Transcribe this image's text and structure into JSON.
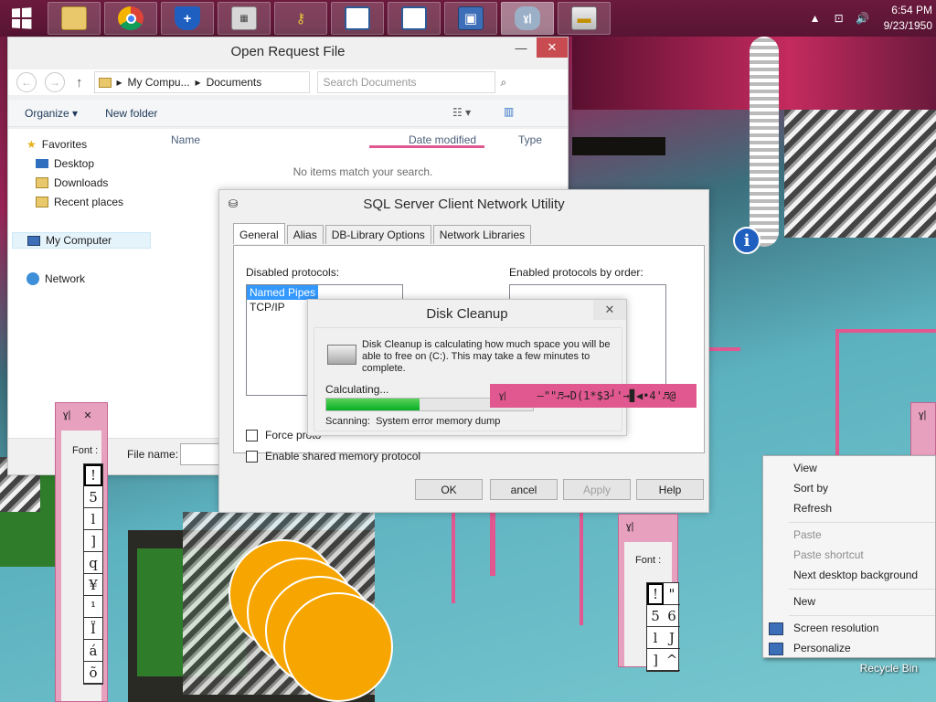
{
  "taskbar": {
    "clock_time": "6:54 PM",
    "clock_date": "9/23/1950",
    "pinned": [
      "file-explorer-icon",
      "chrome-icon",
      "defender-icon",
      "calculator-icon",
      "key-icon",
      "window-icon",
      "window-icon",
      "network-icon",
      "font-viewer-icon",
      "disk-cleanup-icon"
    ]
  },
  "explorer": {
    "title": "Open Request File",
    "address_root": "My Compu...",
    "address_folder": "Documents",
    "search_placeholder": "Search Documents",
    "organize": "Organize",
    "new_folder": "New folder",
    "sidebar": {
      "favorites": "Favorites",
      "desktop": "Desktop",
      "downloads": "Downloads",
      "recent": "Recent places",
      "mycomputer": "My Computer",
      "network": "Network"
    },
    "columns": {
      "name": "Name",
      "date": "Date modified",
      "type": "Type"
    },
    "empty": "No items match your search.",
    "file_name_label": "File name:"
  },
  "sql": {
    "title": "SQL Server Client Network Utility",
    "tabs": [
      "General",
      "Alias",
      "DB-Library Options",
      "Network Libraries"
    ],
    "disabled_label": "Disabled protocols:",
    "enabled_label": "Enabled protocols by order:",
    "disabled_items": [
      "Named Pipes",
      "TCP/IP"
    ],
    "force_label": "Force proto",
    "shared_label": "Enable shared memory protocol",
    "ok": "OK",
    "cancel": "ancel",
    "apply": "Apply",
    "help": "Help"
  },
  "disk": {
    "title": "Disk Cleanup",
    "message": "Disk Cleanup is calculating how much space you will be able to free on  (C:). This may take a few minutes to complete.",
    "calculating": "Calculating...",
    "scanning_label": "Scanning:",
    "scanning_value": "System error memory dump",
    "progress": 0.45
  },
  "font_windows": {
    "label": "Font :",
    "left_glyphs": [
      "!",
      "5",
      "l",
      "]",
      "q",
      "¥",
      "¹",
      "Ï",
      "á",
      "õ"
    ],
    "right_glyphs_col1": [
      "!",
      "5",
      "l",
      "]"
    ],
    "right_glyphs_col2": [
      "\"",
      "6",
      "J",
      "^"
    ]
  },
  "garbled_title": "–\"\"♬→D(1*$3┘'→▊◀•4'♬@",
  "context_menu": {
    "view": "View",
    "sort_by": "Sort by",
    "refresh": "Refresh",
    "paste": "Paste",
    "paste_shortcut": "Paste shortcut",
    "next_bg": "Next desktop background",
    "new": "New",
    "screen_res": "Screen resolution",
    "personalize": "Personalize"
  },
  "recycle_bin": "Recycle Bin",
  "info_glyph": "i"
}
